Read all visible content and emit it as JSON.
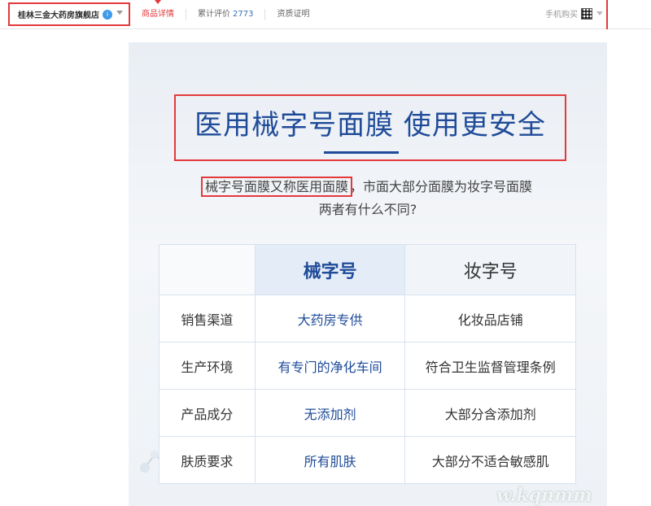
{
  "header": {
    "store_name": "桂林三金大药房旗舰店",
    "badge": "i",
    "tabs": [
      {
        "label": "商品详情",
        "active": true
      },
      {
        "label": "累计评价",
        "count": "2773"
      },
      {
        "label": "资质证明"
      }
    ],
    "mobile_label": "手机购买"
  },
  "content": {
    "title": "医用械字号面膜 使用更安全",
    "subtitle_highlight": "械字号面膜又称医用面膜",
    "subtitle_rest": "，市面大部分面膜为妆字号面膜",
    "subtitle_line2": "两者有什么不同?",
    "table": {
      "headers": [
        "",
        "械字号",
        "妆字号"
      ],
      "rows": [
        [
          "销售渠道",
          "大药房专供",
          "化妆品店铺"
        ],
        [
          "生产环境",
          "有专门的净化车间",
          "符合卫生监督管理条例"
        ],
        [
          "产品成分",
          "无添加剂",
          "大部分含添加剂"
        ],
        [
          "肤质要求",
          "所有肌肤",
          "大部分不适合敏感肌"
        ]
      ]
    },
    "watermark": "w.kqnmm"
  },
  "colors": {
    "accent_red": "#e4393c",
    "brand_blue": "#1f4b99"
  }
}
